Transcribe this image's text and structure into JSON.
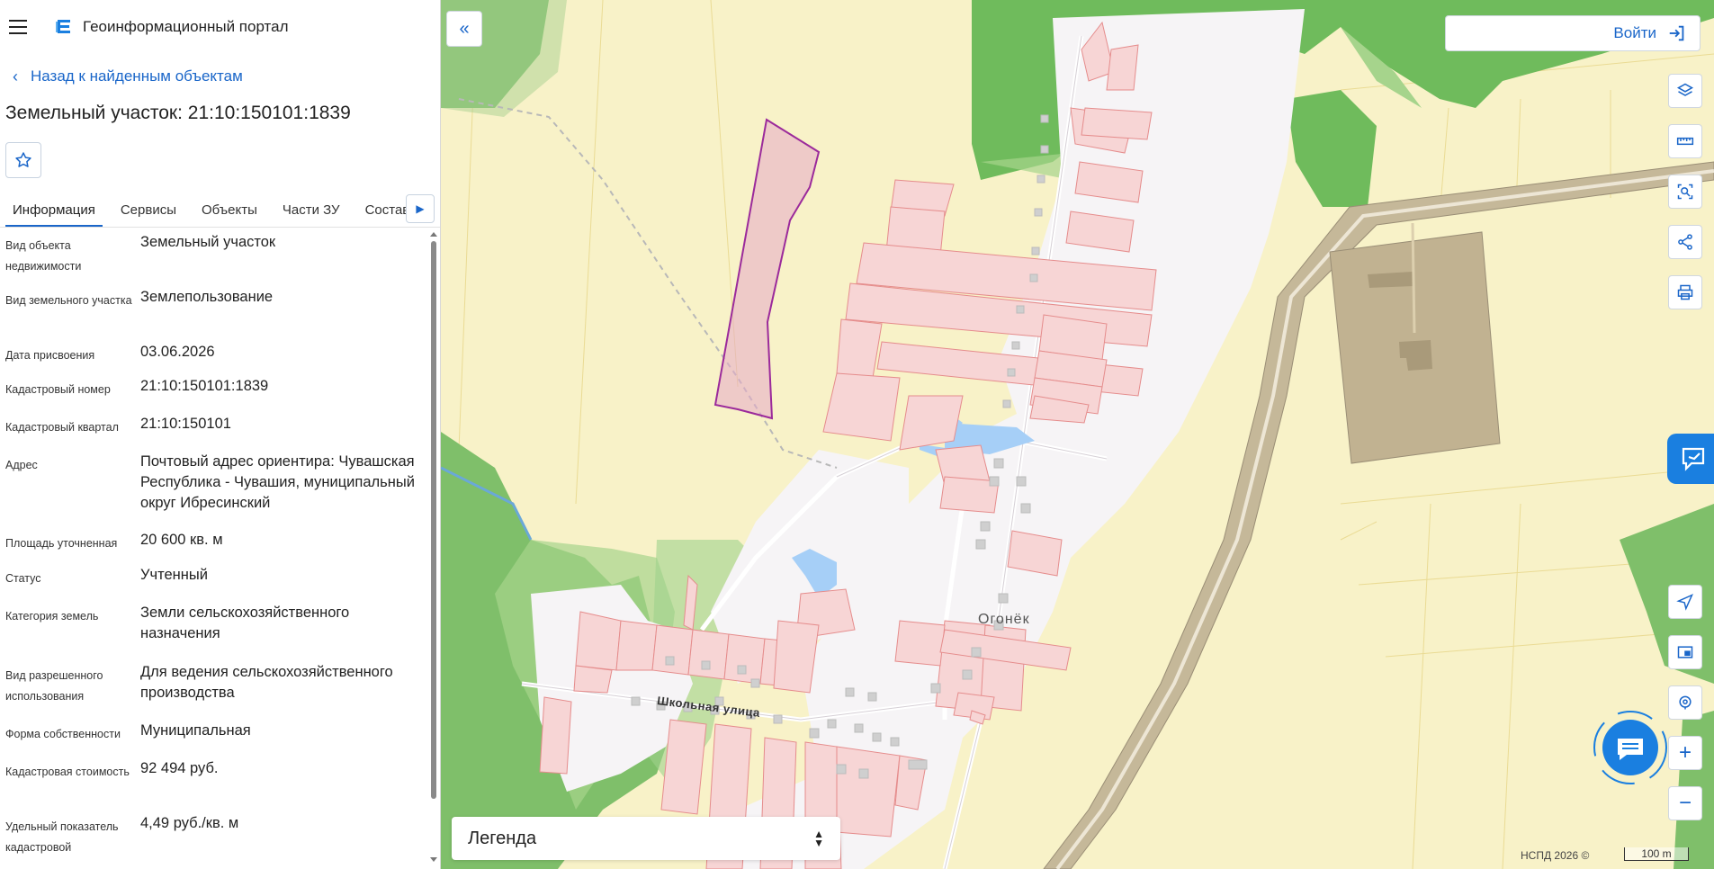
{
  "header": {
    "portal_title": "Геоинформационный портал"
  },
  "nav": {
    "back_label": "Назад к найденным объектам"
  },
  "object": {
    "title": "Земельный участок: 21:10:150101:1839"
  },
  "tabs": [
    {
      "label": "Информация"
    },
    {
      "label": "Сервисы"
    },
    {
      "label": "Объекты"
    },
    {
      "label": "Части ЗУ"
    },
    {
      "label": "Состав"
    }
  ],
  "info_rows": [
    {
      "label": "Вид объекта недвижимости",
      "value": "Земельный участок"
    },
    {
      "label": "Вид земельного участка",
      "value": "Землепользование"
    },
    {
      "label": "Дата присвоения",
      "value": "03.06.2026"
    },
    {
      "label": "Кадастровый номер",
      "value": "21:10:150101:1839"
    },
    {
      "label": "Кадастровый квартал",
      "value": "21:10:150101"
    },
    {
      "label": "Адрес",
      "value": "Почтовый адрес ориентира: Чувашская Республика - Чувашия, муниципальный округ Ибресинский"
    },
    {
      "label": "Площадь уточненная",
      "value": "20 600 кв. м"
    },
    {
      "label": "Статус",
      "value": "Учтенный"
    },
    {
      "label": "Категория земель",
      "value": "Земли сельскохозяйственного назначения"
    },
    {
      "label": "Вид разрешенного использования",
      "value": "Для ведения сельскохозяйственного производства"
    },
    {
      "label": "Форма собственности",
      "value": "Муниципальная"
    },
    {
      "label": "Кадастровая стоимость",
      "value": "92 494 руб."
    },
    {
      "label": "Удельный показатель кадастровой",
      "value": "4,49 руб./кв. м"
    }
  ],
  "map": {
    "login_label": "Войти",
    "legend_label": "Легенда",
    "street_label": "Школьная улица",
    "place_label": "Огонёк",
    "copyright": "НСПД 2026 ©",
    "scale_label": "100 m"
  },
  "icons": {
    "menu": "hamburger-icon",
    "back": "chevron-left-icon",
    "favorite": "star-icon",
    "collapse": "double-chevron-left-icon",
    "login": "login-arrow-icon",
    "layers": "layers-icon",
    "ruler": "ruler-icon",
    "select": "area-select-icon",
    "share": "share-icon",
    "print": "print-icon",
    "locate": "navigation-arrow-icon",
    "minimap": "minimap-icon",
    "geo": "geolocation-icon",
    "zoom_in": "plus-icon",
    "zoom_out": "minus-icon",
    "chat": "chat-icon"
  },
  "colors": {
    "accent": "#1a66c9",
    "parcel_selected": "#9b2a9b",
    "parcel_fill": "#f7d5d5",
    "forest": "#7fbf6a",
    "field": "#f8f2c8",
    "road": "#c8b79a"
  }
}
